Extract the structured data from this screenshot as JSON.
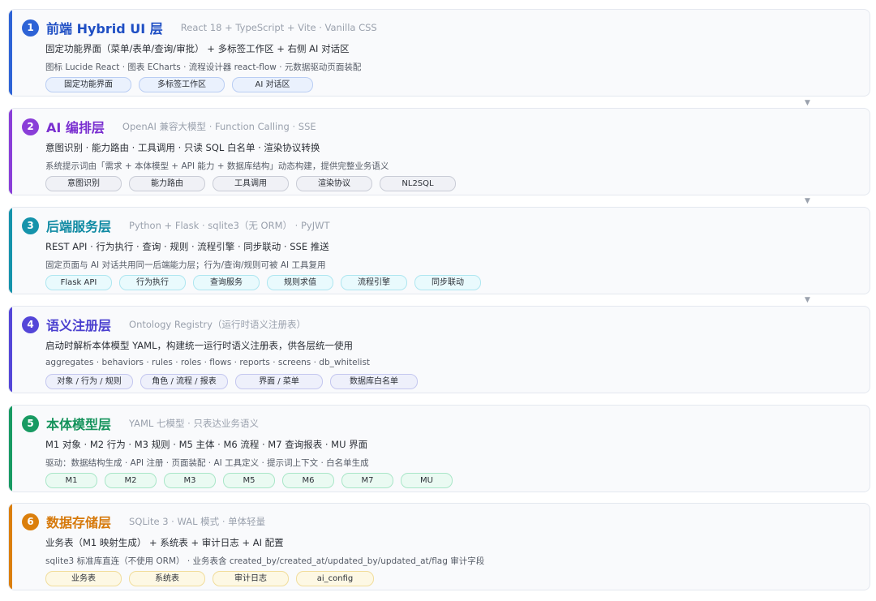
{
  "layers": [
    {
      "number": "1",
      "title": "前端 Hybrid UI 层",
      "tech": "React 18 + TypeScript + Vite · Vanilla CSS",
      "line1": "固定功能界面（菜单/表单/查询/审批） + 多标签工作区 + 右侧 AI 对话区",
      "line2": "图标 Lucide React · 图表 ECharts · 流程设计器 react-flow · 元数据驱动页面装配",
      "tags": [
        "固定功能界面",
        "多标签工作区",
        "AI 对话区"
      ],
      "color": "#2e63d6"
    },
    {
      "number": "2",
      "title": "AI 编排层",
      "tech": "OpenAI 兼容大模型 · Function Calling · SSE",
      "line1": "意图识别 · 能力路由 · 工具调用 · 只读 SQL 白名单 · 渲染协议转换",
      "line2": "系统提示词由「需求 + 本体模型 + API 能力 + 数据库结构」动态构建，提供完整业务语义",
      "tags": [
        "意图识别",
        "能力路由",
        "工具调用",
        "渲染协议",
        "NL2SQL"
      ],
      "color": "#8a3ed8"
    },
    {
      "number": "3",
      "title": "后端服务层",
      "tech": "Python + Flask · sqlite3（无 ORM） · PyJWT",
      "line1": "REST API · 行为执行 · 查询 · 规则 · 流程引擎 · 同步联动 · SSE 推送",
      "line2": "固定页面与 AI 对话共用同一后端能力层；行为/查询/规则可被 AI 工具复用",
      "tags": [
        "Flask API",
        "行为执行",
        "查询服务",
        "规则求值",
        "流程引擎",
        "同步联动"
      ],
      "color": "#1593ab"
    },
    {
      "number": "4",
      "title": "语义注册层",
      "tech": "Ontology Registry（运行时语义注册表）",
      "line1": "启动时解析本体模型 YAML，构建统一运行时语义注册表，供各层统一使用",
      "line2": "aggregates · behaviors · rules · roles · flows · reports · screens · db_whitelist",
      "tags": [
        "对象 / 行为 / 规则",
        "角色 / 流程 / 报表",
        "界面 / 菜单",
        "数据库白名单"
      ],
      "color": "#5446d8"
    },
    {
      "number": "5",
      "title": "本体模型层",
      "tech": "YAML 七模型 · 只表达业务语义",
      "line1": "M1 对象 · M2 行为 · M3 规则 · M5 主体 · M6 流程 · M7 查询报表 · MU 界面",
      "line2": "驱动：数据结构生成 · API 注册 · 页面装配 · AI 工具定义 · 提示词上下文 · 白名单生成",
      "tags": [
        "M1",
        "M2",
        "M3",
        "M5",
        "M6",
        "M7",
        "MU"
      ],
      "color": "#189a62"
    },
    {
      "number": "6",
      "title": "数据存储层",
      "tech": "SQLite 3 · WAL 模式 · 单体轻量",
      "line1": "业务表（M1 映射生成） + 系统表 + 审计日志 + AI 配置",
      "line2": "sqlite3 标准库直连（不使用 ORM） · 业务表含 created_by/created_at/updated_by/updated_at/flag 审计字段",
      "tags": [
        "业务表",
        "系统表",
        "审计日志",
        "ai_config"
      ],
      "color": "#db7f0c"
    }
  ],
  "arrow_glyph": "▼"
}
